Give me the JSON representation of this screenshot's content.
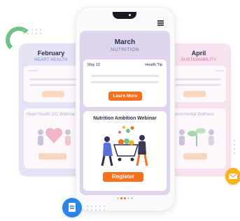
{
  "calendar": {
    "left_card": {
      "month": "February",
      "topic": "HEART HEALTH",
      "card_title": "Heart Health 101 Webinar"
    },
    "center_card": {
      "month": "March",
      "topic": "NUTRITION",
      "tip_date": "May 12",
      "tip_label": "Health Tip",
      "learn_more": "Learn More",
      "webinar_title": "Nutrition Ambition Webinar",
      "register": "Register"
    },
    "right_card": {
      "month": "April",
      "topic": "SUSTAINABILITY",
      "card_title": "Environmental Wellness"
    }
  },
  "colors": {
    "accent_orange": "#f4711f",
    "feb_topic": "#6d86d8",
    "april_topic": "#d96aa6",
    "center_panel": "#ddd5ee",
    "icon_blue": "#2b86e8",
    "mail_yellow": "#f7b31b",
    "arc_green": "#6dc28a"
  },
  "icons": [
    "hamburger-menu-icon",
    "mail-icon",
    "document-icon"
  ]
}
